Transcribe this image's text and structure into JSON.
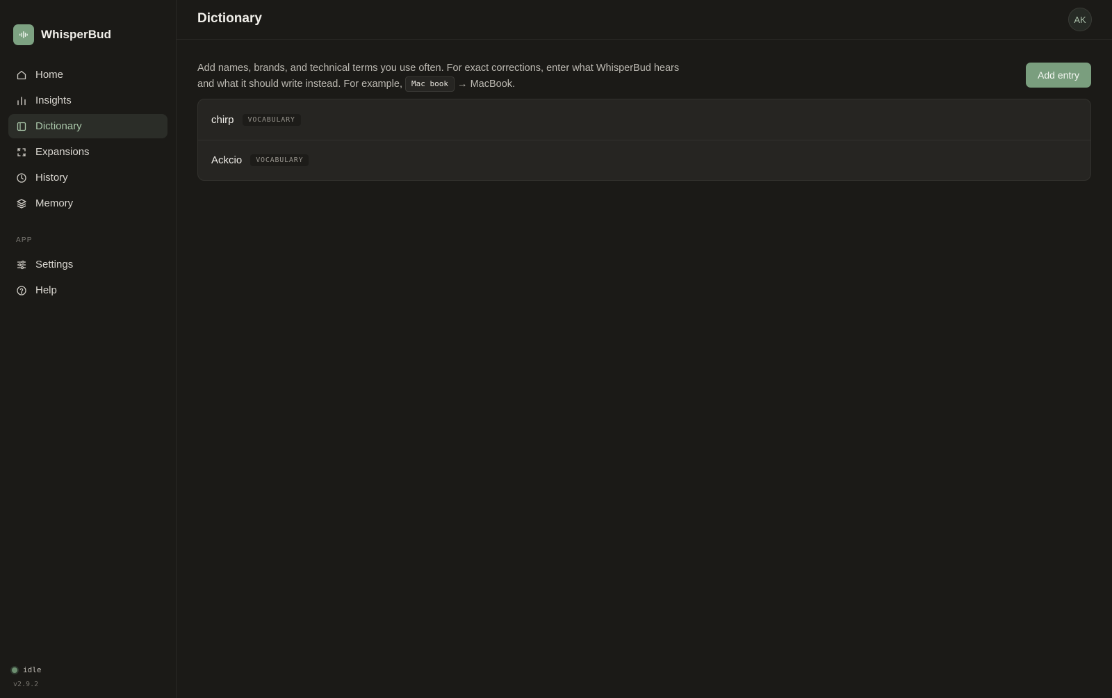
{
  "brand": {
    "name": "WhisperBud",
    "icon": "waveform-icon",
    "accent": "#7da282"
  },
  "nav": {
    "items": [
      {
        "label": "Home",
        "icon": "home-icon"
      },
      {
        "label": "Insights",
        "icon": "bar-chart-icon"
      },
      {
        "label": "Dictionary",
        "icon": "book-icon",
        "active": true
      },
      {
        "label": "Expansions",
        "icon": "expand-icon"
      },
      {
        "label": "History",
        "icon": "clock-icon"
      },
      {
        "label": "Memory",
        "icon": "layers-icon"
      }
    ],
    "section_label": "APP",
    "app_items": [
      {
        "label": "Settings",
        "icon": "sliders-icon"
      },
      {
        "label": "Help",
        "icon": "help-circle-icon"
      }
    ]
  },
  "status": {
    "text": "idle",
    "version": "v2.9.2"
  },
  "header": {
    "title": "Dictionary",
    "avatar_initials": "AK"
  },
  "intro": {
    "text_before": "Add names, brands, and technical terms you use often. For exact corrections, enter what WhisperBud hears and what it should write instead. For example, ",
    "example_heard": "Mac book",
    "arrow": "→",
    "example_written": "MacBook."
  },
  "actions": {
    "add_entry_label": "Add entry"
  },
  "entries": [
    {
      "term": "chirp",
      "tag": "VOCABULARY"
    },
    {
      "term": "Ackcio",
      "tag": "VOCABULARY"
    }
  ],
  "colors": {
    "background": "#1b1a17",
    "active_nav_bg": "#2b2d28",
    "active_nav_text": "#a9c6a9",
    "button": "#7a9e7e",
    "card": "#262522"
  }
}
